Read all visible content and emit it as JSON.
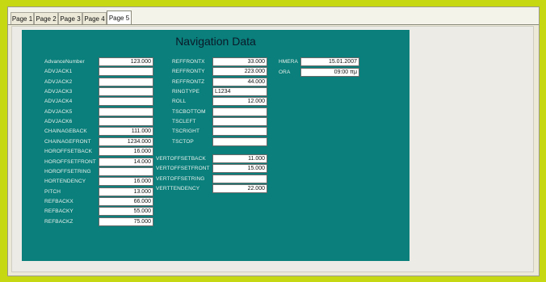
{
  "tabs": [
    "Page 1",
    "Page 2",
    "Page 3",
    "Page 4",
    "Page 5"
  ],
  "active_tab": 4,
  "title": "Navigation Data",
  "col1": [
    {
      "label": "AdvanceNumber",
      "value": "123.000"
    },
    {
      "label": "ADVJACK1",
      "value": ""
    },
    {
      "label": "ADVJACK2",
      "value": ""
    },
    {
      "label": "ADVJACK3",
      "value": ""
    },
    {
      "label": "ADVJACK4",
      "value": ""
    },
    {
      "label": "ADVJACK5",
      "value": ""
    },
    {
      "label": "ADVJACK6",
      "value": ""
    },
    {
      "label": "CHAINAGEBACK",
      "value": "111.000"
    },
    {
      "label": "CHAINAGEFRONT",
      "value": "1234.000"
    },
    {
      "label": "HOROFFSETBACK",
      "value": "16.000"
    },
    {
      "label": "HOROFFSETFRONT",
      "value": "14.000"
    },
    {
      "label": "HOROFFSETRING",
      "value": ""
    },
    {
      "label": "HORTENDENCY",
      "value": "16.000"
    },
    {
      "label": "PITCH",
      "value": "13.000"
    },
    {
      "label": "REFBACKX",
      "value": "66.000"
    },
    {
      "label": "REFBACKY",
      "value": "55.000"
    },
    {
      "label": "REFBACKZ",
      "value": "75.000"
    }
  ],
  "col2": [
    {
      "label": "REFFRONTX",
      "value": "33.000"
    },
    {
      "label": "REFFRONTY",
      "value": "223.000"
    },
    {
      "label": "REFFRONTZ",
      "value": "44.000"
    },
    {
      "label": "RINGTYPE",
      "value": "L1234",
      "align": "left"
    },
    {
      "label": "ROLL",
      "value": "12.000"
    },
    {
      "label": "TSCBOTTOM",
      "value": ""
    },
    {
      "label": "TSCLEFT",
      "value": ""
    },
    {
      "label": "TSCRIGHT",
      "value": ""
    },
    {
      "label": "TSCTOP",
      "value": ""
    }
  ],
  "col2b": [
    {
      "label": "VERTOFFSETBACK",
      "value": "11.000"
    },
    {
      "label": "VERTOFFSETFRONT",
      "value": "15.000"
    },
    {
      "label": "VERTOFFSETRING",
      "value": ""
    },
    {
      "label": "VERTTENDENCY",
      "value": "22.000"
    }
  ],
  "col3": [
    {
      "label": "HMERA",
      "value": "15.01.2007"
    },
    {
      "label": "ORA",
      "value": "09:00 πμ"
    }
  ]
}
